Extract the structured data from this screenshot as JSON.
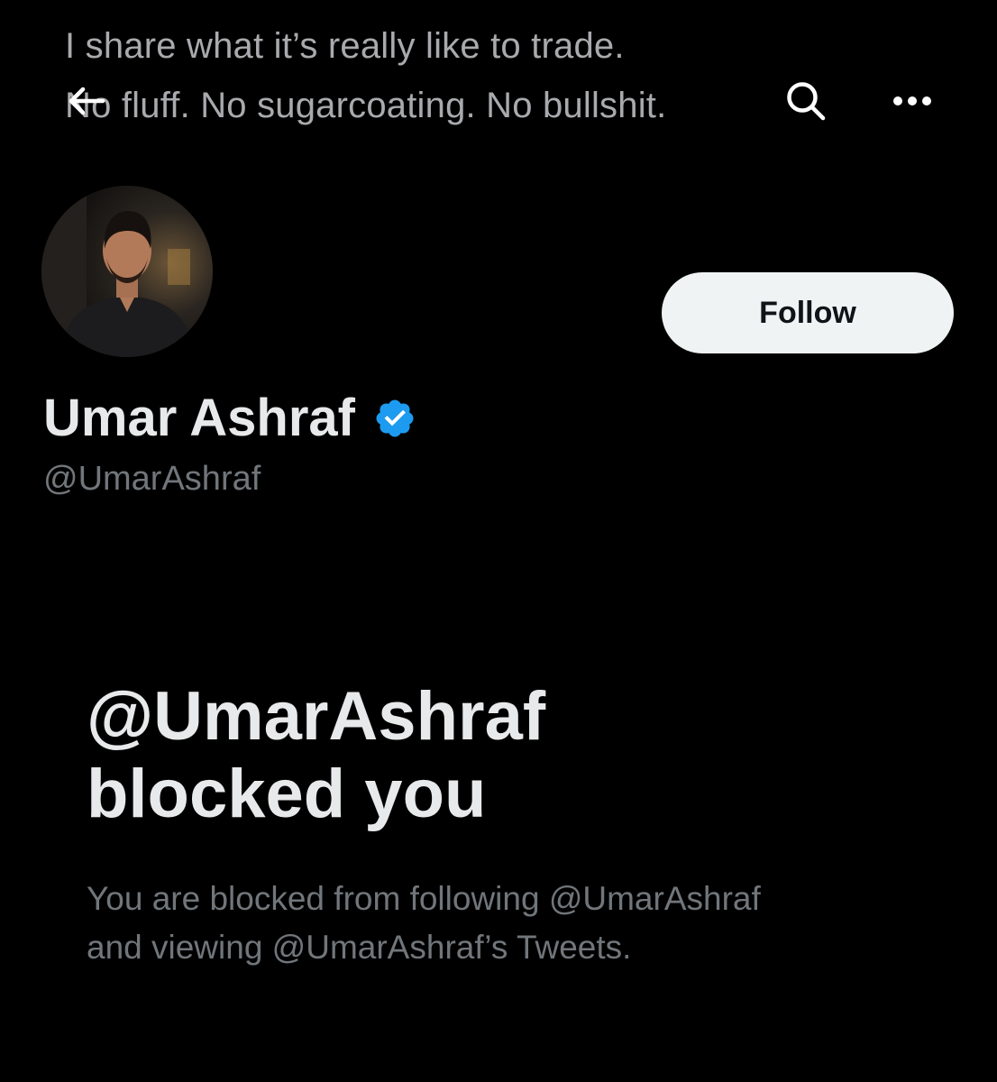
{
  "header": {
    "bio_line_1": "I share what it’s really like to trade.",
    "bio_line_2": "No fluff. No sugarcoating. No bullshit.",
    "back_icon": "arrow-left-icon",
    "search_icon": "search-icon",
    "more_icon": "more-horizontal-icon"
  },
  "profile": {
    "display_name": "Umar Ashraf",
    "handle": "@UmarAshraf",
    "verified": true,
    "verified_color": "#1d9bf0",
    "follow_label": "Follow"
  },
  "blocked": {
    "title_line_1": "@UmarAshraf",
    "title_line_2": "blocked you",
    "desc_line_1": "You are blocked from following @UmarAshraf",
    "desc_line_2": "and viewing @UmarAshraf’s Tweets."
  }
}
